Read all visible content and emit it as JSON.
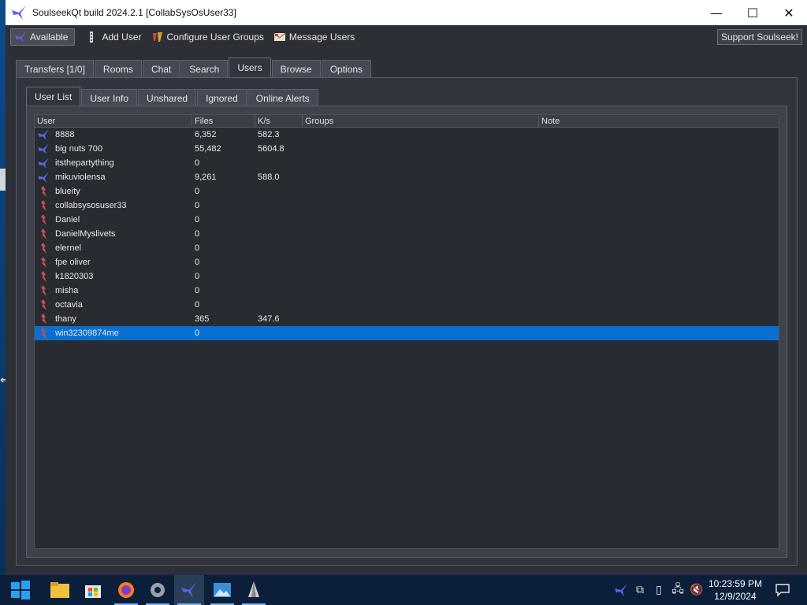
{
  "window": {
    "title": "SoulseekQt build 2024.2.1 [CollabSysOsUser33]",
    "controls": {
      "minimize": "—",
      "maximize": "☐",
      "close": "✕"
    }
  },
  "toolbar": {
    "status_label": "Available",
    "add_user": "Add User",
    "configure_groups": "Configure User Groups",
    "message_users": "Message Users",
    "support": "Support Soulseek!"
  },
  "main_tabs": [
    {
      "label": "Transfers [1/0]",
      "active": false
    },
    {
      "label": "Rooms",
      "active": false
    },
    {
      "label": "Chat",
      "active": false
    },
    {
      "label": "Search",
      "active": false
    },
    {
      "label": "Users",
      "active": true
    },
    {
      "label": "Browse",
      "active": false
    },
    {
      "label": "Options",
      "active": false
    }
  ],
  "sub_tabs": [
    {
      "label": "User List",
      "active": true
    },
    {
      "label": "User Info",
      "active": false
    },
    {
      "label": "Unshared",
      "active": false
    },
    {
      "label": "Ignored",
      "active": false
    },
    {
      "label": "Online Alerts",
      "active": false
    }
  ],
  "table": {
    "columns": [
      "User",
      "Files",
      "K/s",
      "Groups",
      "Note"
    ],
    "rows": [
      {
        "user": "8888",
        "files": "6,352",
        "ks": "582.3",
        "groups": "",
        "note": "",
        "status": "online",
        "selected": false
      },
      {
        "user": "big nuts 700",
        "files": "55,482",
        "ks": "5604.8",
        "groups": "",
        "note": "",
        "status": "online",
        "selected": false
      },
      {
        "user": "itsthepartything",
        "files": "0",
        "ks": "",
        "groups": "",
        "note": "",
        "status": "online",
        "selected": false
      },
      {
        "user": "mikuviolensa",
        "files": "9,261",
        "ks": "588.0",
        "groups": "",
        "note": "",
        "status": "online",
        "selected": false
      },
      {
        "user": "blueity",
        "files": "0",
        "ks": "",
        "groups": "",
        "note": "",
        "status": "offline",
        "selected": false
      },
      {
        "user": "collabsysosuser33",
        "files": "0",
        "ks": "",
        "groups": "",
        "note": "",
        "status": "offline",
        "selected": false
      },
      {
        "user": "Daniel",
        "files": "0",
        "ks": "",
        "groups": "",
        "note": "",
        "status": "offline",
        "selected": false
      },
      {
        "user": "DanielMyslivets",
        "files": "0",
        "ks": "",
        "groups": "",
        "note": "",
        "status": "offline",
        "selected": false
      },
      {
        "user": "elernel",
        "files": "0",
        "ks": "",
        "groups": "",
        "note": "",
        "status": "offline",
        "selected": false
      },
      {
        "user": "fpe oliver",
        "files": "0",
        "ks": "",
        "groups": "",
        "note": "",
        "status": "offline",
        "selected": false
      },
      {
        "user": "k1820303",
        "files": "0",
        "ks": "",
        "groups": "",
        "note": "",
        "status": "offline",
        "selected": false
      },
      {
        "user": "misha",
        "files": "0",
        "ks": "",
        "groups": "",
        "note": "",
        "status": "offline",
        "selected": false
      },
      {
        "user": "octavia",
        "files": "0",
        "ks": "",
        "groups": "",
        "note": "",
        "status": "offline",
        "selected": false
      },
      {
        "user": "thany",
        "files": "365",
        "ks": "347.6",
        "groups": "",
        "note": "",
        "status": "offline",
        "selected": false
      },
      {
        "user": "win32309874me",
        "files": "0",
        "ks": "",
        "groups": "",
        "note": "",
        "status": "offline",
        "selected": true
      }
    ]
  },
  "colors": {
    "online_icon": "#5b63e0",
    "offline_icon": "#c0504a",
    "selection": "#0a6fd0",
    "window_bg": "#2d2f36"
  },
  "taskbar": {
    "apps": [
      "windows-start-icon",
      "file-explorer-icon",
      "store-icon",
      "firefox-icon",
      "settings-gear-icon",
      "soulseek-icon",
      "photos-icon",
      "inkscape-icon"
    ],
    "clock_time": "10:23:59 PM",
    "clock_date": "12/9/2024"
  }
}
